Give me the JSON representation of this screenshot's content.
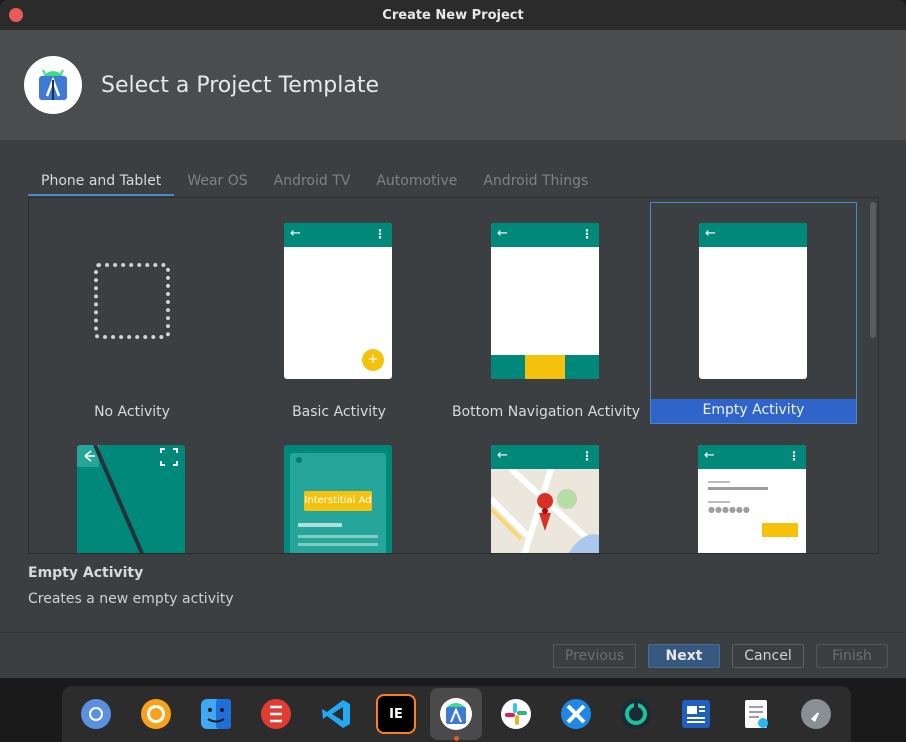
{
  "window": {
    "title": "Create New Project"
  },
  "header": {
    "title": "Select a Project Template"
  },
  "tabs": [
    {
      "label": "Phone and Tablet",
      "active": true
    },
    {
      "label": "Wear OS"
    },
    {
      "label": "Android TV"
    },
    {
      "label": "Automotive"
    },
    {
      "label": "Android Things"
    }
  ],
  "templates": [
    {
      "label": "No Activity"
    },
    {
      "label": "Basic Activity"
    },
    {
      "label": "Bottom Navigation Activity"
    },
    {
      "label": "Empty Activity",
      "selected": true
    },
    {
      "label": ""
    },
    {
      "label": "",
      "preview_text": "Interstitial Ad"
    },
    {
      "label": ""
    },
    {
      "label": ""
    }
  ],
  "description": {
    "title": "Empty Activity",
    "text": "Creates a new empty activity"
  },
  "buttons": {
    "previous": "Previous",
    "next": "Next",
    "cancel": "Cancel",
    "finish": "Finish"
  },
  "colors": {
    "accent": "#00897b",
    "fab": "#f4c20d",
    "selection": "#2f65ca"
  },
  "dock": [
    {
      "name": "chromium",
      "icon": "chromium-icon"
    },
    {
      "name": "ubuntu software",
      "icon": "circle-icon"
    },
    {
      "name": "finder",
      "icon": "finder-icon"
    },
    {
      "name": "app",
      "icon": "red-app-icon"
    },
    {
      "name": "vscode",
      "icon": "vscode-icon"
    },
    {
      "name": "intellij",
      "icon": "intellij-icon",
      "text": "IE"
    },
    {
      "name": "android studio",
      "icon": "android-studio-icon",
      "active": true
    },
    {
      "name": "slack",
      "icon": "slack-icon"
    },
    {
      "name": "app",
      "icon": "x-icon"
    },
    {
      "name": "app",
      "icon": "ring-icon"
    },
    {
      "name": "news",
      "icon": "news-icon"
    },
    {
      "name": "notes",
      "icon": "notes-icon"
    },
    {
      "name": "launcher",
      "icon": "rocket-icon"
    }
  ]
}
